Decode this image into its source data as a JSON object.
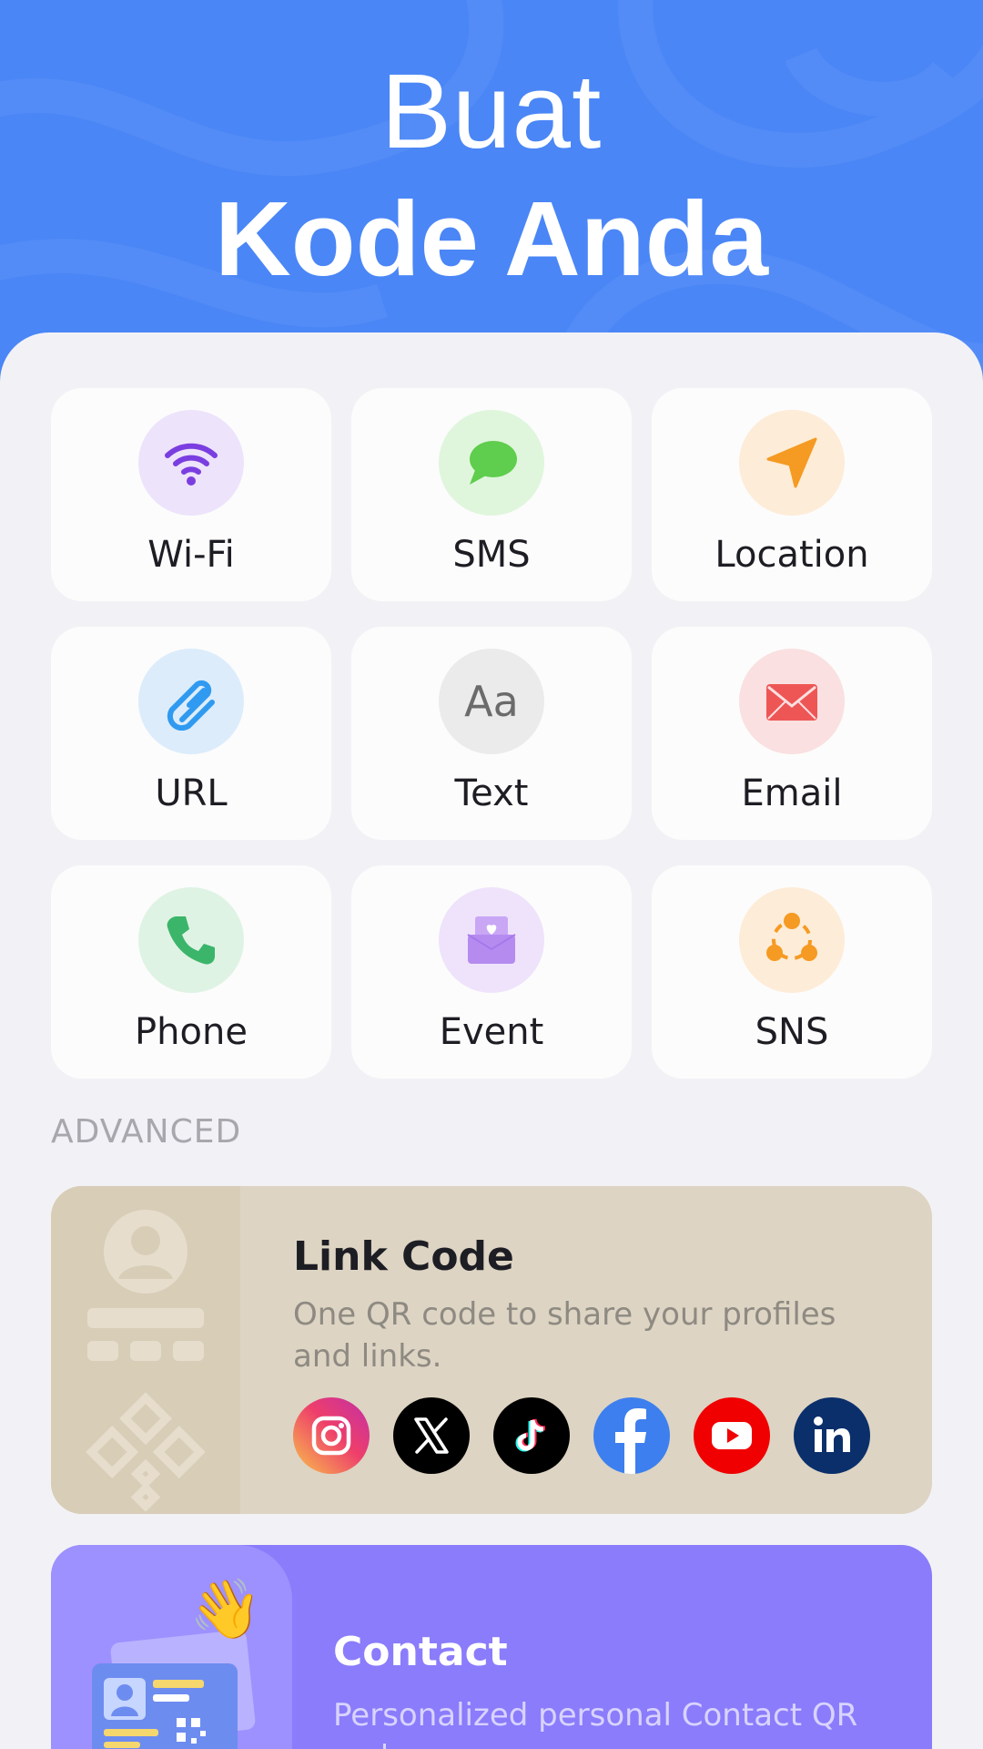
{
  "header": {
    "line1": "Buat",
    "line2": "Kode Anda"
  },
  "types": [
    {
      "label": "Wi-Fi",
      "icon": "wifi-icon",
      "bg": "#ede3fb",
      "color": "#7a3ee0"
    },
    {
      "label": "SMS",
      "icon": "chat-bubble-icon",
      "bg": "#dff6dc",
      "color": "#5fcd4d"
    },
    {
      "label": "Location",
      "icon": "navigation-arrow-icon",
      "bg": "#fdecd7",
      "color": "#f59a22"
    },
    {
      "label": "URL",
      "icon": "paperclip-icon",
      "bg": "#dcecfb",
      "color": "#2f9af0"
    },
    {
      "label": "Text",
      "icon": "text-aa-icon",
      "glyph": "Aa",
      "bg": "#ebebeb",
      "color": "#6b6b6b"
    },
    {
      "label": "Email",
      "icon": "envelope-icon",
      "bg": "#fae0e0",
      "color": "#ee5656"
    },
    {
      "label": "Phone",
      "icon": "phone-icon",
      "bg": "#dff3e4",
      "color": "#3bb56a"
    },
    {
      "label": "Event",
      "icon": "invitation-icon",
      "bg": "#efe3fb",
      "color": "#b58bf0"
    },
    {
      "label": "SNS",
      "icon": "share-nodes-icon",
      "bg": "#fdecd7",
      "color": "#f59a22"
    }
  ],
  "advanced": {
    "section_label": "ADVANCED",
    "link_code": {
      "title": "Link Code",
      "description": "One QR code to share your profiles and links.",
      "socials": [
        {
          "name": "instagram-icon",
          "bg": "#e1306c"
        },
        {
          "name": "x-icon",
          "bg": "#000000"
        },
        {
          "name": "tiktok-icon",
          "bg": "#000000"
        },
        {
          "name": "facebook-icon",
          "bg": "#3d7fee"
        },
        {
          "name": "youtube-icon",
          "bg": "#f00000"
        },
        {
          "name": "linkedin-icon",
          "bg": "#0a2f6b"
        }
      ]
    },
    "contact": {
      "title": "Contact",
      "description": "Personalized personal Contact QR codes"
    }
  },
  "colors": {
    "hero": "#4a86f6",
    "background": "#f2f2f6",
    "link_card": "#ddd4c3",
    "contact_card": "#8a7cfb"
  }
}
